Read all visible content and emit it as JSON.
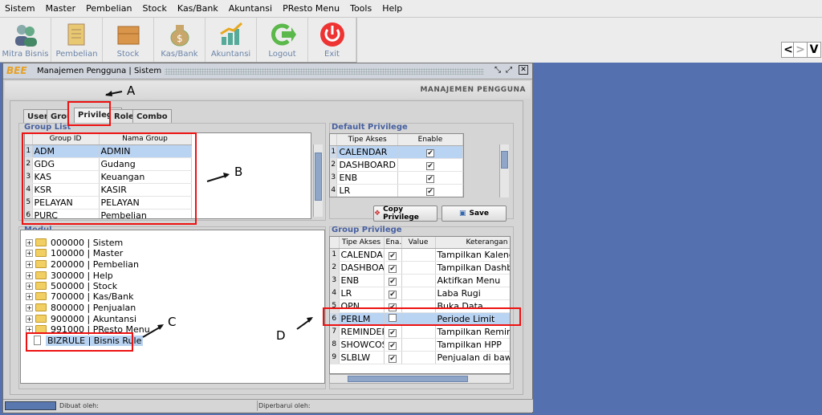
{
  "menu": [
    "Sistem",
    "Master",
    "Pembelian",
    "Stock",
    "Kas/Bank",
    "Akuntansi",
    "PResto Menu",
    "Tools",
    "Help"
  ],
  "toolbar": [
    "Mitra Bisnis",
    "Pembelian",
    "Stock",
    "Kas/Bank",
    "Akuntansi",
    "Logout",
    "Exit"
  ],
  "nav": {
    "prev": "<",
    "next": ">",
    "v": "V"
  },
  "window": {
    "logo": "BEE",
    "title": "Manajemen Pengguna | Sistem",
    "header": "MANAJEMEN PENGGUNA"
  },
  "tabs": [
    "User",
    "Group",
    "Privilege",
    "Role",
    "Combo"
  ],
  "group_list": {
    "label": "Group List",
    "cols": [
      "Group ID",
      "Nama Group"
    ],
    "rows": [
      [
        "1",
        "ADM",
        "ADMIN"
      ],
      [
        "2",
        "GDG",
        "Gudang"
      ],
      [
        "3",
        "KAS",
        "Keuangan"
      ],
      [
        "4",
        "KSR",
        "KASIR"
      ],
      [
        "5",
        "PELAYAN",
        "PELAYAN"
      ],
      [
        "6",
        "PURC",
        "Pembelian"
      ]
    ]
  },
  "default_priv": {
    "label": "Default Privilege",
    "cols": [
      "Tipe Akses",
      "Enable"
    ],
    "rows": [
      [
        "1",
        "CALENDAR",
        "✔"
      ],
      [
        "2",
        "DASHBOARD",
        "✔"
      ],
      [
        "3",
        "ENB",
        "✔"
      ],
      [
        "4",
        "LR",
        "✔"
      ]
    ],
    "copy_btn": "Copy Privilege",
    "save_btn": "Save"
  },
  "modul": {
    "label": "Modul",
    "items": [
      "000000 | Sistem",
      "100000 | Master",
      "200000 | Pembelian",
      "300000 | Help",
      "500000 | Stock",
      "700000 | Kas/Bank",
      "800000 | Penjualan",
      "900000 | Akuntansi",
      "991000 | PResto Menu"
    ],
    "leaf": "BIZRULE | Bisnis Rule"
  },
  "group_priv": {
    "label": "Group Privilege",
    "cols": [
      "Tipe Akses",
      "Ena...",
      "Value",
      "Keterangan"
    ],
    "rows": [
      [
        "1",
        "CALENDAR",
        "✔",
        "",
        "Tampilkan Kalendar"
      ],
      [
        "2",
        "DASHBOAR",
        "✔",
        "",
        "Tampilkan Dashboar"
      ],
      [
        "3",
        "ENB",
        "✔",
        "",
        "Aktifkan Menu"
      ],
      [
        "4",
        "LR",
        "✔",
        "",
        "Laba Rugi"
      ],
      [
        "5",
        "OPN",
        "✔",
        "",
        "Buka Data"
      ],
      [
        "6",
        "PERLM",
        "",
        "",
        "Periode Limit"
      ],
      [
        "7",
        "REMINDER",
        "✔",
        "",
        "Tampilkan Reminder"
      ],
      [
        "8",
        "SHOWCOST",
        "✔",
        "",
        "Tampilkan HPP"
      ],
      [
        "9",
        "SLBLW",
        "✔",
        "",
        "Penjualan di bawah I"
      ]
    ]
  },
  "annotations": {
    "a": "A",
    "b": "B",
    "c": "C",
    "d": "D"
  },
  "status": {
    "created": "Dibuat oleh:",
    "updated": "Diperbarui oleh:"
  },
  "colors": {
    "desktop": "#5470ae",
    "selection": "#b9d3f2",
    "label": "#4760a0",
    "highlight": "#e11111"
  }
}
